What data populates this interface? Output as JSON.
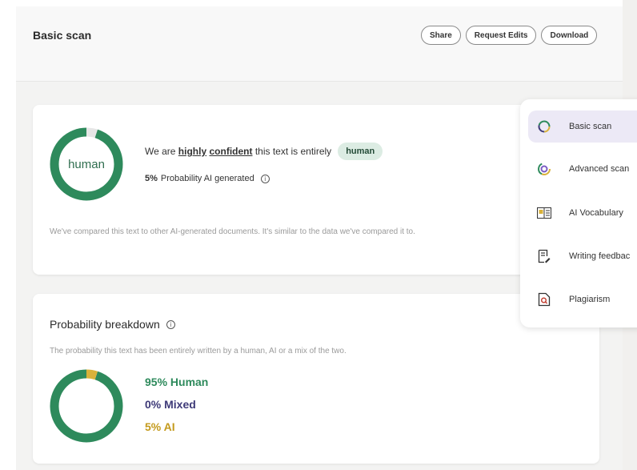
{
  "header": {
    "title": "Basic scan",
    "buttons": {
      "share": "Share",
      "request_edits": "Request Edits",
      "download": "Download"
    }
  },
  "result_card": {
    "donut_label": "human",
    "verdict_prefix": "We are ",
    "verdict_highly": "highly",
    "verdict_confident": "confident",
    "verdict_suffix": " this text is entirely",
    "verdict_badge": "human",
    "prob_percent": "5%",
    "prob_text": "Probability AI generated",
    "compare_text": "We've compared this text to other AI-generated documents. It's similar to the data we've compared it to.",
    "ai_fraction": 0.05
  },
  "breakdown": {
    "title": "Probability breakdown",
    "subtitle": "The probability this text has been entirely written by a human, AI or a mix of the two.",
    "human": "95% Human",
    "mixed": "0% Mixed",
    "ai": "5% AI",
    "values": {
      "human": 95,
      "mixed": 0,
      "ai": 5
    }
  },
  "menu": {
    "items": [
      {
        "label": "Basic scan",
        "icon": "ring-icon"
      },
      {
        "label": "Advanced scan",
        "icon": "target-icon"
      },
      {
        "label": "AI Vocabulary",
        "icon": "book-icon"
      },
      {
        "label": "Writing feedbac",
        "icon": "doc-edit-icon"
      },
      {
        "label": "Plagiarism",
        "icon": "doc-search-icon"
      }
    ]
  },
  "colors": {
    "human": "#2e8a5c",
    "mixed": "#3e3a78",
    "ai": "#d9b23a",
    "track": "#e6e6e6",
    "active_menu": "#ece9f6"
  }
}
